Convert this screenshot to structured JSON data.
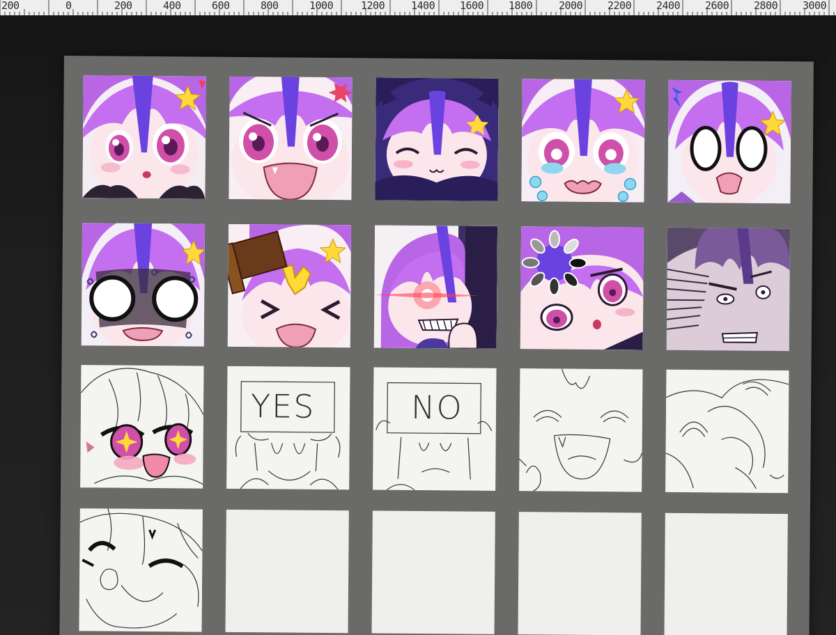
{
  "ruler": {
    "labels": [
      "200",
      "0",
      "200",
      "400",
      "600",
      "800",
      "1000",
      "1200",
      "1400",
      "1600",
      "1800",
      "2000",
      "2200",
      "2400",
      "2600",
      "2800",
      "3000"
    ]
  },
  "colors": {
    "hair": "#b866e6",
    "hair_dark": "#7a3fd4",
    "bangs_accent": "#6a42e0",
    "skin": "#fbe6ec",
    "blush": "#f6a8c0",
    "eye": "#d04fa8",
    "star": "#ffd83a",
    "ribbon": "#e8446a",
    "board": "#6a6a68"
  },
  "emotes": [
    {
      "icon": "shy-emote-icon"
    },
    {
      "icon": "angry-emote-icon"
    },
    {
      "icon": "smug-hood-emote-icon"
    },
    {
      "icon": "crying-emote-icon"
    },
    {
      "icon": "shocked-emote-icon"
    },
    {
      "icon": "nervous-sweat-emote-icon"
    },
    {
      "icon": "bonk-hammer-emote-icon"
    },
    {
      "icon": "peek-glowing-eye-emote-icon"
    },
    {
      "icon": "loading-spinner-emote-icon"
    },
    {
      "icon": "disgusted-emote-icon"
    },
    {
      "icon": "sparkle-eyes-emote-icon"
    },
    {
      "icon": "yes-sign-sketch-icon",
      "sign": "YES"
    },
    {
      "icon": "no-sign-sketch-icon",
      "sign": "NO"
    },
    {
      "icon": "laughing-sketch-icon"
    },
    {
      "icon": "facepalm-sketch-icon"
    },
    {
      "icon": "wink-sketch-icon"
    },
    {
      "icon": "empty-slot"
    },
    {
      "icon": "empty-slot"
    },
    {
      "icon": "empty-slot"
    },
    {
      "icon": "empty-slot"
    }
  ]
}
